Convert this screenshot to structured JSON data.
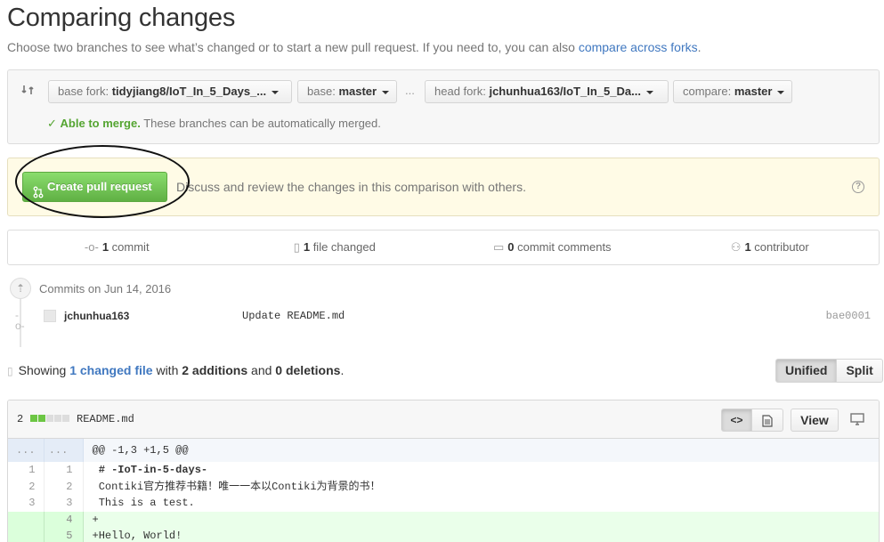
{
  "page": {
    "title": "Comparing changes",
    "subtitle_text": "Choose two branches to see what’s changed or to start a new pull request. If you need to, you can also ",
    "subtitle_link": "compare across forks",
    "subtitle_end": "."
  },
  "range": {
    "base_fork_label": "base fork:",
    "base_fork_value": "tidyjiang8/IoT_In_5_Days_...",
    "base_label": "base:",
    "base_value": "master",
    "ellipsis": "...",
    "head_fork_label": "head fork:",
    "head_fork_value": "jchunhua163/IoT_In_5_Da...",
    "compare_label": "compare:",
    "compare_value": "master",
    "merge_ok": "Able to merge.",
    "merge_text": "These branches can be automatically merged."
  },
  "pull_request": {
    "button_label": "Create pull request",
    "description": "Discuss and review the changes in this comparison with others.",
    "help": "?"
  },
  "stats": {
    "commits_count": "1",
    "commits_label": "commit",
    "files_count": "1",
    "files_label": "file changed",
    "comments_count": "0",
    "comments_label": "commit comments",
    "contributors_count": "1",
    "contributors_label": "contributor"
  },
  "commits": {
    "group_date": "Commits on Jun 14, 2016",
    "items": [
      {
        "author": "jchunhua163",
        "message": "Update README.md",
        "sha": "bae0001"
      }
    ]
  },
  "toc": {
    "showing": "Showing",
    "changed_files": "1 changed file",
    "with": "with",
    "additions": "2 additions",
    "and": "and",
    "deletions": "0 deletions",
    "end": ".",
    "unified_label": "Unified",
    "split_label": "Split"
  },
  "file": {
    "change_count": "2",
    "name": "README.md",
    "view_label": "View",
    "hunk_left": "...",
    "hunk_right": "...",
    "hunk_header": "@@ -1,3 +1,5 @@",
    "lines": [
      {
        "old": "1",
        "new": "1",
        "text": " # -IoT-in-5-days-"
      },
      {
        "old": "2",
        "new": "2",
        "text": " Contiki官方推荐书籍！唯一一本以Contiki为背景的书！"
      },
      {
        "old": "3",
        "new": "3",
        "text": " This is a test."
      },
      {
        "old": "",
        "new": "4",
        "text": "+"
      },
      {
        "old": "",
        "new": "5",
        "text": "+Hello, World!"
      }
    ]
  },
  "colors": {
    "link": "#4078c0",
    "merge_ok": "#55a532",
    "button_green": "#60b044",
    "addition_bg": "#eaffea"
  },
  "icons": {
    "range": "git-compare-icon",
    "merge": "check-icon",
    "pull_request": "git-pull-request-icon",
    "help": "question-icon",
    "commit": "git-commit-icon",
    "file": "file-diff-icon",
    "comment": "comment-icon",
    "contributor": "organization-icon",
    "desktop": "device-desktop-icon"
  }
}
